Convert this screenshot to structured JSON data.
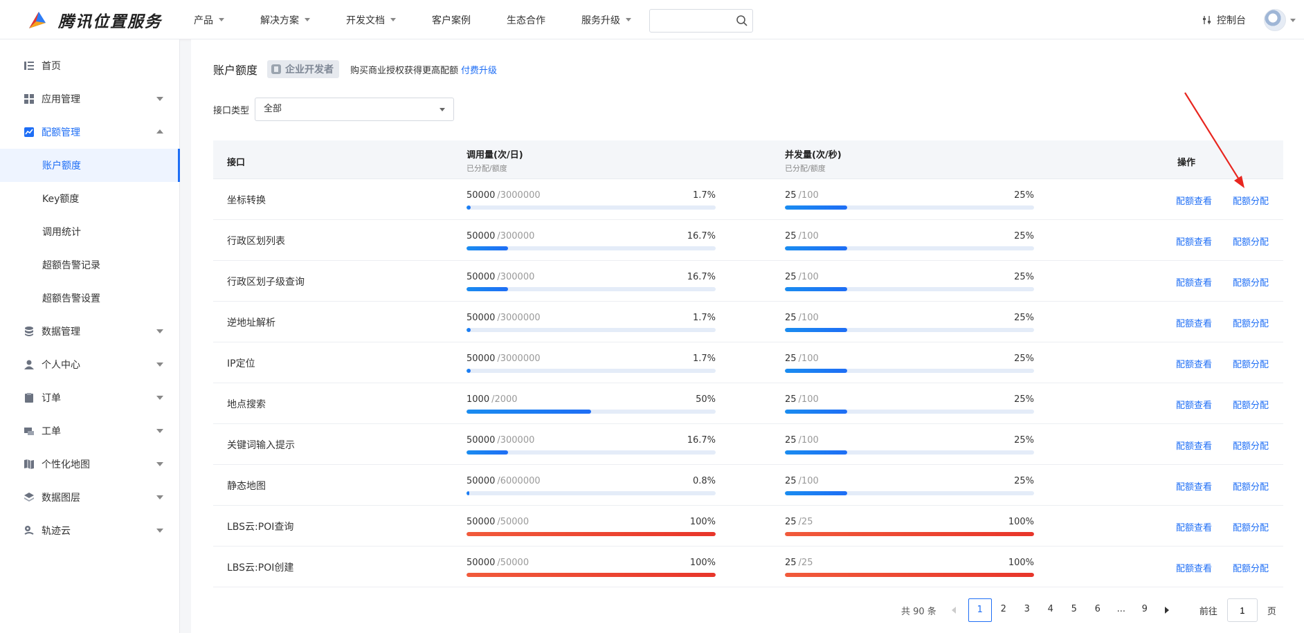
{
  "header": {
    "brand": "腾讯位置服务",
    "nav": [
      {
        "label": "产品",
        "dropdown": true
      },
      {
        "label": "解决方案",
        "dropdown": true
      },
      {
        "label": "开发文档",
        "dropdown": true
      },
      {
        "label": "客户案例",
        "dropdown": false
      },
      {
        "label": "生态合作",
        "dropdown": false
      },
      {
        "label": "服务升级",
        "dropdown": true
      }
    ],
    "search_placeholder": "",
    "console_label": "控制台"
  },
  "sidebar": {
    "items": [
      {
        "label": "首页",
        "icon": "list-icon"
      },
      {
        "label": "应用管理",
        "icon": "grid-icon"
      },
      {
        "label": "配额管理",
        "icon": "chart-icon"
      },
      {
        "label": "数据管理",
        "icon": "database-icon"
      },
      {
        "label": "个人中心",
        "icon": "user-icon"
      },
      {
        "label": "订单",
        "icon": "clipboard-icon"
      },
      {
        "label": "工单",
        "icon": "ticket-icon"
      },
      {
        "label": "个性化地图",
        "icon": "map-style-icon"
      },
      {
        "label": "数据图层",
        "icon": "layers-icon"
      },
      {
        "label": "轨迹云",
        "icon": "track-icon"
      }
    ],
    "subitems": [
      "账户额度",
      "Key额度",
      "调用统计",
      "超额告警记录",
      "超额告警设置"
    ]
  },
  "main": {
    "title": "账户额度",
    "badge": "企业开发者",
    "upgrade_hint": "购买商业授权获得更高配额",
    "upgrade_link": "付费升级",
    "filter_label": "接口类型",
    "filter_value": "全部"
  },
  "table": {
    "headers": {
      "api": "接口",
      "calls": "调用量(次/日)",
      "calls_sub": "已分配/额度",
      "concurrency": "并发量(次/秒)",
      "concurrency_sub": "已分配/额度",
      "ops": "操作"
    },
    "op_view": "配额查看",
    "op_assign": "配额分配",
    "rows": [
      {
        "name": "坐标转换",
        "calls_used": "50000",
        "calls_quota": "/3000000",
        "calls_pct": "1.7%",
        "calls_ratio": 0.017,
        "conc_used": "25",
        "conc_quota": "/100",
        "conc_pct": "25%",
        "conc_ratio": 0.25
      },
      {
        "name": "行政区划列表",
        "calls_used": "50000",
        "calls_quota": "/300000",
        "calls_pct": "16.7%",
        "calls_ratio": 0.167,
        "conc_used": "25",
        "conc_quota": "/100",
        "conc_pct": "25%",
        "conc_ratio": 0.25
      },
      {
        "name": "行政区划子级查询",
        "calls_used": "50000",
        "calls_quota": "/300000",
        "calls_pct": "16.7%",
        "calls_ratio": 0.167,
        "conc_used": "25",
        "conc_quota": "/100",
        "conc_pct": "25%",
        "conc_ratio": 0.25
      },
      {
        "name": "逆地址解析",
        "calls_used": "50000",
        "calls_quota": "/3000000",
        "calls_pct": "1.7%",
        "calls_ratio": 0.017,
        "conc_used": "25",
        "conc_quota": "/100",
        "conc_pct": "25%",
        "conc_ratio": 0.25
      },
      {
        "name": "IP定位",
        "calls_used": "50000",
        "calls_quota": "/3000000",
        "calls_pct": "1.7%",
        "calls_ratio": 0.017,
        "conc_used": "25",
        "conc_quota": "/100",
        "conc_pct": "25%",
        "conc_ratio": 0.25
      },
      {
        "name": "地点搜索",
        "calls_used": "1000",
        "calls_quota": "/2000",
        "calls_pct": "50%",
        "calls_ratio": 0.5,
        "conc_used": "25",
        "conc_quota": "/100",
        "conc_pct": "25%",
        "conc_ratio": 0.25
      },
      {
        "name": "关键词输入提示",
        "calls_used": "50000",
        "calls_quota": "/300000",
        "calls_pct": "16.7%",
        "calls_ratio": 0.167,
        "conc_used": "25",
        "conc_quota": "/100",
        "conc_pct": "25%",
        "conc_ratio": 0.25
      },
      {
        "name": "静态地图",
        "calls_used": "50000",
        "calls_quota": "/6000000",
        "calls_pct": "0.8%",
        "calls_ratio": 0.008,
        "conc_used": "25",
        "conc_quota": "/100",
        "conc_pct": "25%",
        "conc_ratio": 0.25
      },
      {
        "name": "LBS云:POI查询",
        "calls_used": "50000",
        "calls_quota": "/50000",
        "calls_pct": "100%",
        "calls_ratio": 1.0,
        "conc_used": "25",
        "conc_quota": "/25",
        "conc_pct": "100%",
        "conc_ratio": 1.0
      },
      {
        "name": "LBS云:POI创建",
        "calls_used": "50000",
        "calls_quota": "/50000",
        "calls_pct": "100%",
        "calls_ratio": 1.0,
        "conc_used": "25",
        "conc_quota": "/25",
        "conc_pct": "100%",
        "conc_ratio": 1.0
      }
    ]
  },
  "pagination": {
    "total": "共 90 条",
    "pages": [
      "1",
      "2",
      "3",
      "4",
      "5",
      "6",
      "...",
      "9"
    ],
    "current": "1",
    "goto_label": "前往",
    "goto_value": "1",
    "page_suffix": "页"
  },
  "colors": {
    "accent": "#1e6ef5",
    "danger": "#e8352a",
    "annotation_arrow": "#e8261f"
  }
}
